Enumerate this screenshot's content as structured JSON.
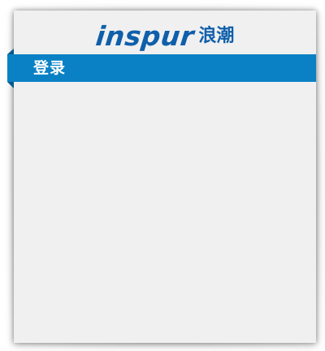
{
  "logo": {
    "latin_text": "inspur",
    "cjk_text": "浪潮"
  },
  "header": {
    "title": "登录"
  },
  "colors": {
    "brand_blue": "#0f5fab",
    "ribbon_blue": "#0a81c4",
    "panel_background": "#f0f0f0"
  }
}
